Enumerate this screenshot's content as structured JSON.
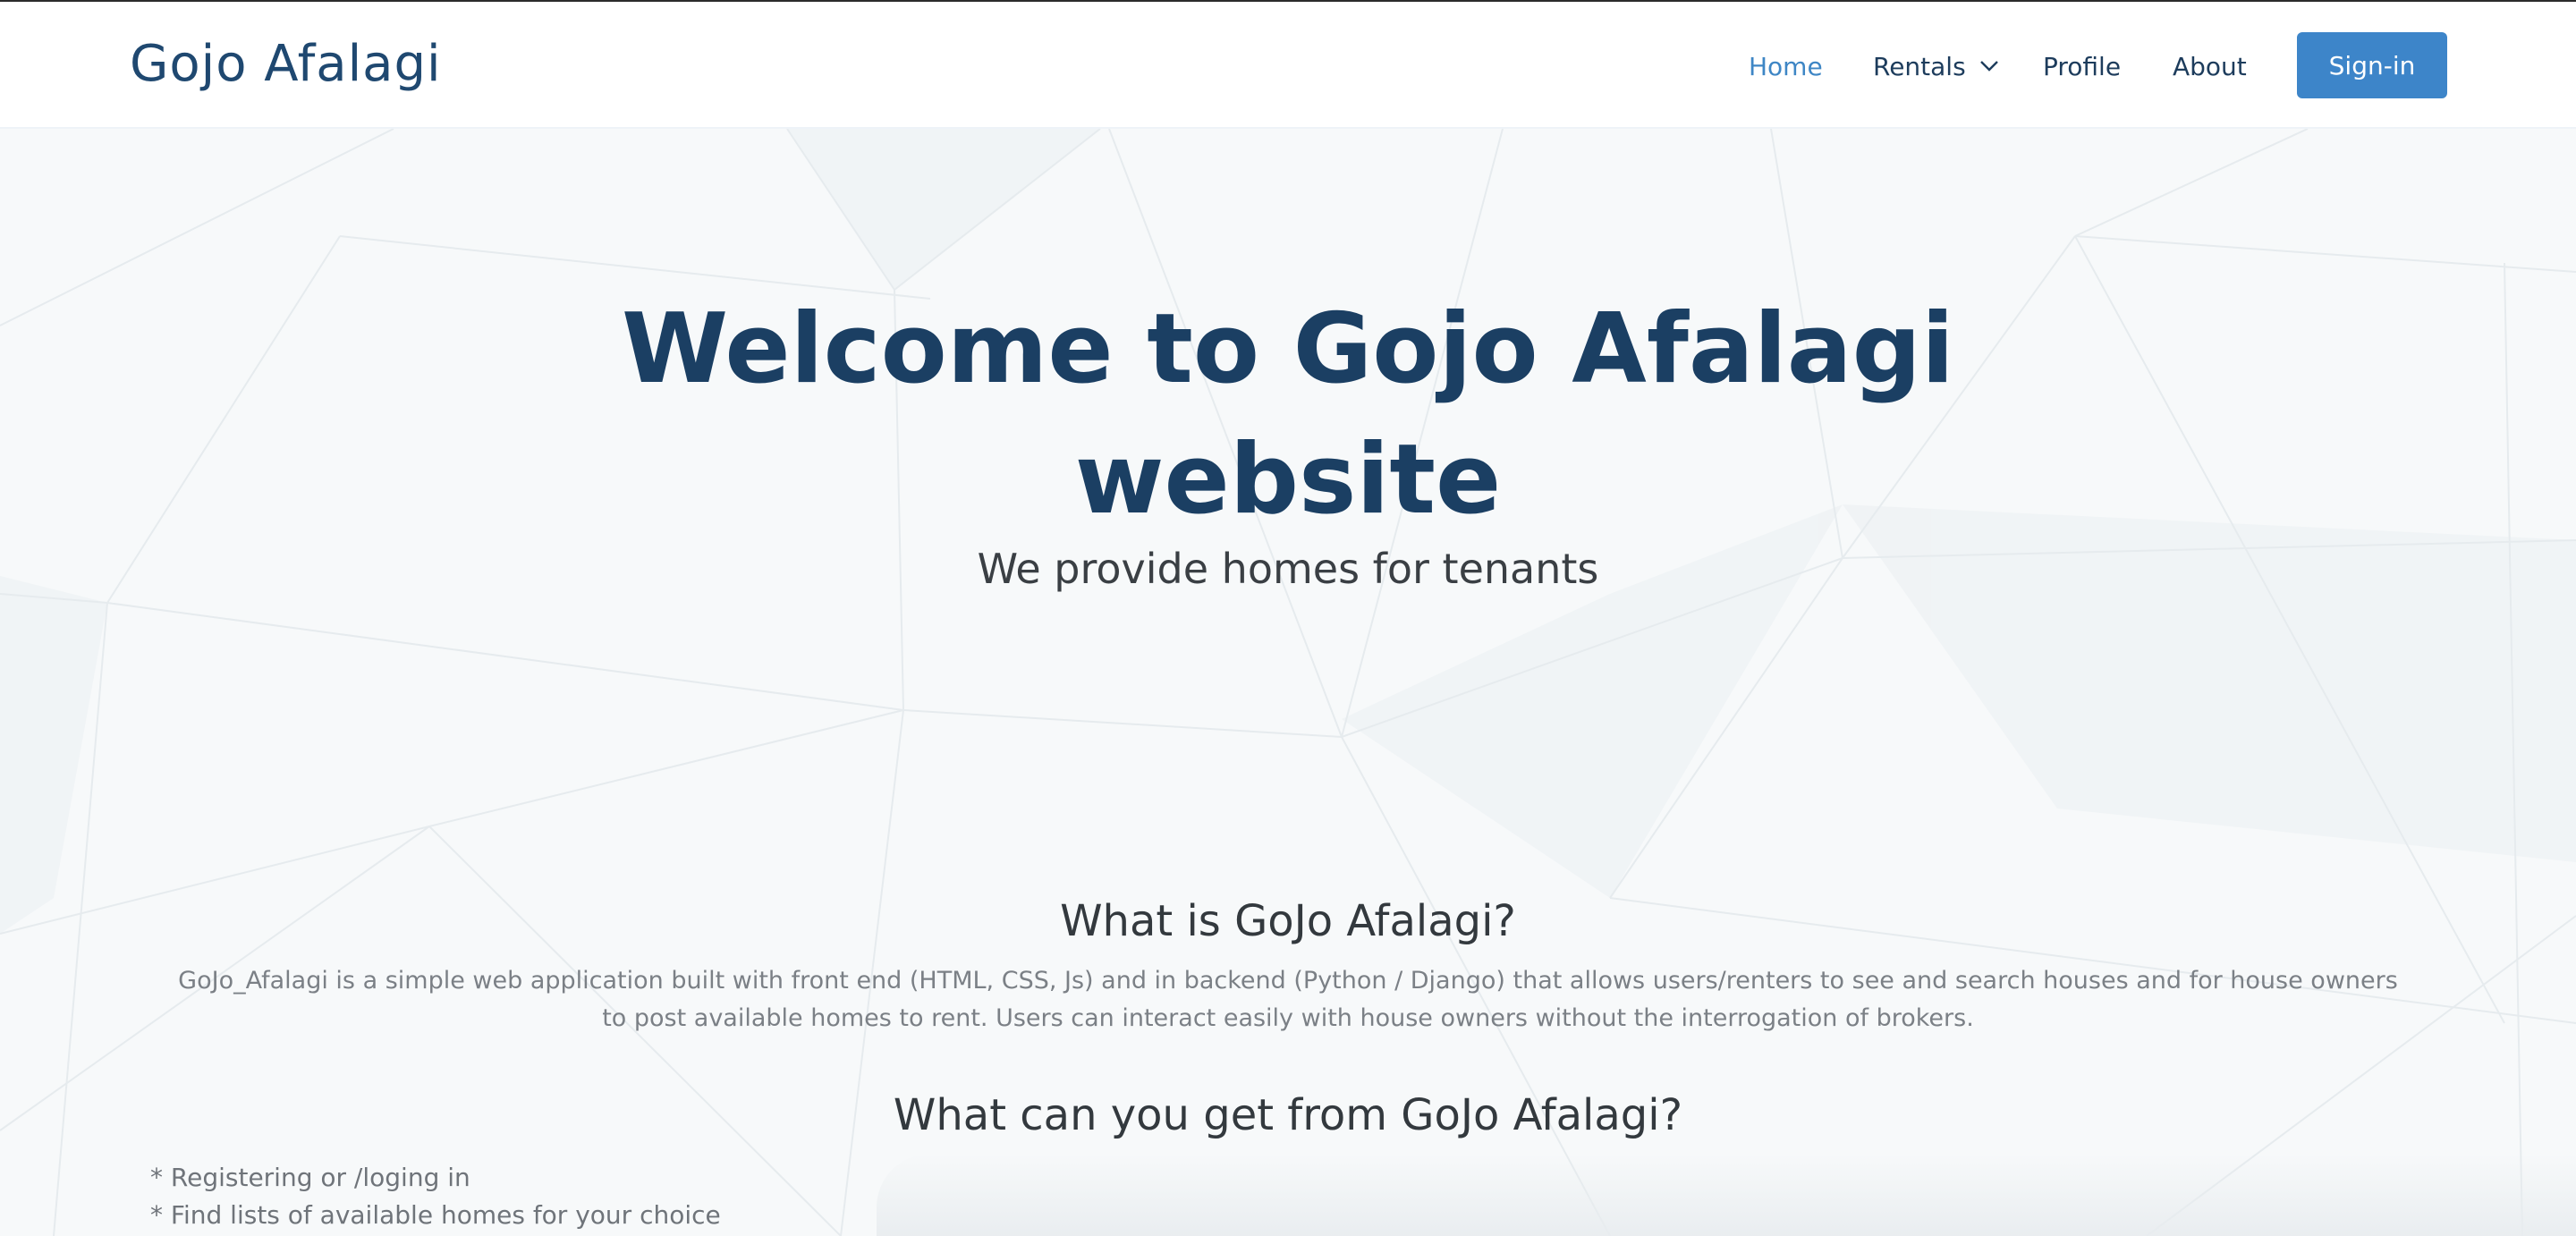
{
  "header": {
    "logo": "Gojo Afalagi",
    "nav": {
      "home": "Home",
      "rentals": "Rentals",
      "profile": "Profile",
      "about": "About"
    },
    "signin_label": "Sign-in"
  },
  "hero": {
    "title": "Welcome to Gojo Afalagi website",
    "subtitle": "We provide homes for tenants"
  },
  "about": {
    "heading": "What is GoJo Afalagi?",
    "description": "GoJo_Afalagi is a simple web application built with front end (HTML, CSS, Js) and in backend (Python / Django) that allows users/renters to see and search houses and for house owners to post available homes to rent. Users can interact easily with house owners without the interrogation of brokers."
  },
  "benefits": {
    "heading": "What can you get from GoJo Afalagi?",
    "items": [
      "* Registering or /loging in",
      "* Find lists of available homes for your choice"
    ]
  },
  "colors": {
    "brand": "#1f4870",
    "accent": "#3d85c9",
    "hero_title": "#1b3f63",
    "background": "#f7f9fa"
  },
  "icons": {
    "rentals_dropdown": "chevron-down-icon"
  }
}
